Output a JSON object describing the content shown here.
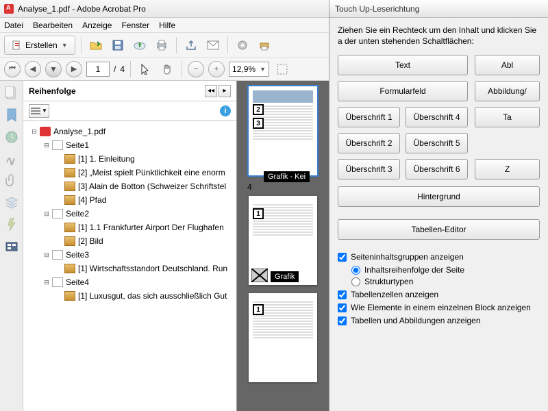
{
  "title": "Analyse_1.pdf - Adobe Acrobat Pro",
  "menu": [
    "Datei",
    "Bearbeiten",
    "Anzeige",
    "Fenster",
    "Hilfe"
  ],
  "create_label": "Erstellen",
  "page_current": "1",
  "page_total": "4",
  "zoom": "12,9%",
  "order_panel_title": "Reihenfolge",
  "tree": {
    "root": "Analyse_1.pdf",
    "pages": [
      {
        "label": "Seite1",
        "items": [
          "[1]  1. Einleitung",
          "[2]  „Meist spielt Pünktlichkeit eine enorm",
          "[3]  Alain de Botton (Schweizer Schriftstel",
          "[4]  Pfad"
        ]
      },
      {
        "label": "Seite2",
        "items": [
          "[1]  1.1 Frankfurter Airport Der Flughafen",
          "[2]  Bild"
        ]
      },
      {
        "label": "Seite3",
        "items": [
          "[1]  Wirtschaftsstandort Deutschland. Run"
        ]
      },
      {
        "label": "Seite4",
        "items": [
          "[1]  Luxusgut, das sich ausschließlich Gut"
        ]
      }
    ]
  },
  "thumb_overlays": {
    "p1_n4": "4",
    "p1_label": "Grafik - Kei",
    "p2_n1": "1",
    "p2_n2": "2",
    "p2_label": "Grafik",
    "p3_n1": "1"
  },
  "touchup": {
    "title": "Touch Up-Leserichtung",
    "instr": "Ziehen Sie ein Rechteck um den Inhalt und klicken Sie a der unten stehenden Schaltflächen:",
    "col1": [
      "Text",
      "Formularfeld",
      "Überschrift 1",
      "Überschrift 2",
      "Überschrift 3"
    ],
    "col2_top": [
      "Abl",
      "Abbildung/"
    ],
    "col2_mid": [
      "Überschrift 4",
      "Überschrift 5",
      "Überschrift 6"
    ],
    "col3": [
      "Ta",
      "",
      "Z"
    ],
    "background": "Hintergrund",
    "table_editor": "Tabellen-Editor",
    "chk1": "Seiteninhaltsgruppen anzeigen",
    "radio1": "Inhaltsreihenfolge der Seite",
    "radio2": "Strukturtypen",
    "chk2": "Tabellenzellen anzeigen",
    "chk3": "Wie Elemente in einem einzelnen Block anzeigen",
    "chk4": "Tabellen und Abbildungen anzeigen"
  }
}
